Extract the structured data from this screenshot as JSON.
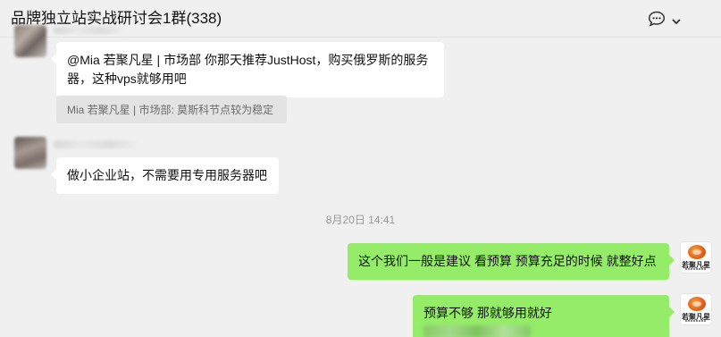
{
  "header": {
    "title": "品牌独立站实战研讨会1群(338)",
    "more_icon": "chat-bubble-dots-icon",
    "chevron_icon": "chevron-down-icon"
  },
  "messages": [
    {
      "side": "left",
      "text": "@Mia 若聚凡星 | 市场部 你那天推荐JustHost，购买俄罗斯的服务器，这种vps就够用吧",
      "quote": "Mia 若聚凡星 | 市场部: 莫斯科节点较为稳定"
    },
    {
      "side": "left",
      "text": "做小企业站，不需要用专用服务器吧"
    },
    {
      "side": "right",
      "text": "这个我们一般是建议 看预算 预算充足的时候 就整好点"
    },
    {
      "side": "right",
      "text": "预算不够 那就够用就好"
    }
  ],
  "timestamp": "8月20日 14:41",
  "brand_avatar_text": "若聚凡星",
  "colors": {
    "background": "#f0f0f0",
    "sent_bubble": "#95ec69",
    "received_bubble": "#ffffff"
  }
}
